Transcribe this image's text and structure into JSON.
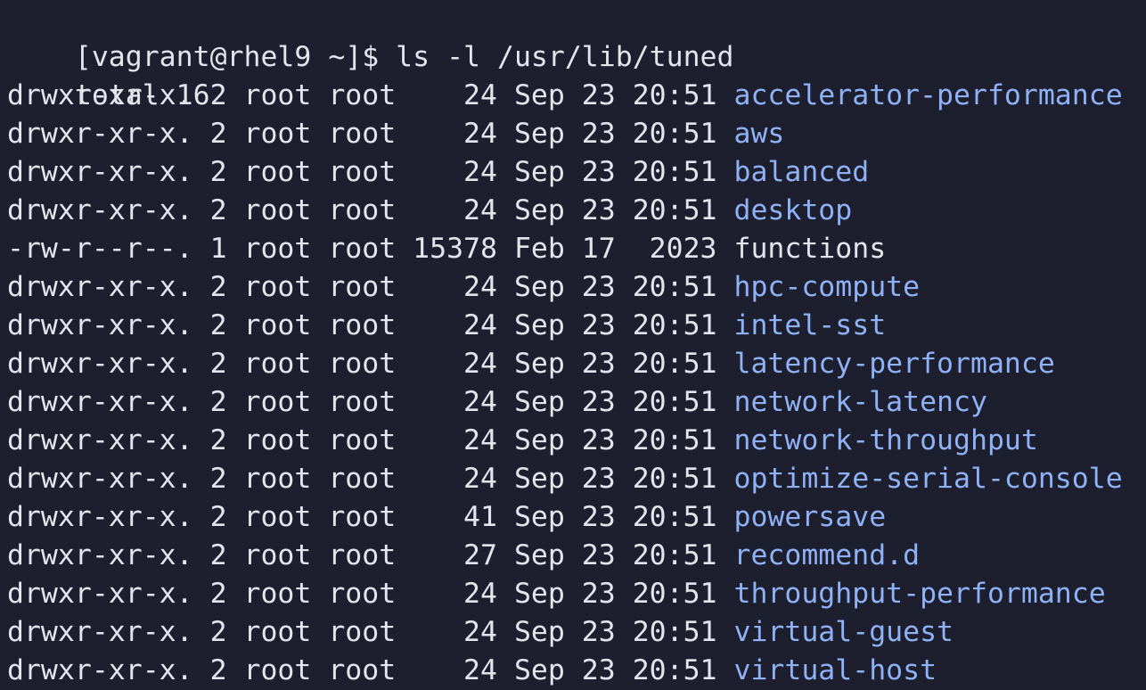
{
  "terminal": {
    "prompt": "[vagrant@rhel9 ~]$ ls -l /usr/lib/tuned",
    "total": "total 16",
    "colors": {
      "background": "#1e1f2e",
      "text": "#e3e5ec",
      "directory": "#8fb1f5"
    },
    "entries": [
      {
        "meta": "drwxr-xr-x. 2 root root    24 Sep 23 20:51 ",
        "name": "accelerator-performance",
        "type": "dir"
      },
      {
        "meta": "drwxr-xr-x. 2 root root    24 Sep 23 20:51 ",
        "name": "aws",
        "type": "dir"
      },
      {
        "meta": "drwxr-xr-x. 2 root root    24 Sep 23 20:51 ",
        "name": "balanced",
        "type": "dir"
      },
      {
        "meta": "drwxr-xr-x. 2 root root    24 Sep 23 20:51 ",
        "name": "desktop",
        "type": "dir"
      },
      {
        "meta": "-rw-r--r--. 1 root root 15378 Feb 17  2023 ",
        "name": "functions",
        "type": "file"
      },
      {
        "meta": "drwxr-xr-x. 2 root root    24 Sep 23 20:51 ",
        "name": "hpc-compute",
        "type": "dir"
      },
      {
        "meta": "drwxr-xr-x. 2 root root    24 Sep 23 20:51 ",
        "name": "intel-sst",
        "type": "dir"
      },
      {
        "meta": "drwxr-xr-x. 2 root root    24 Sep 23 20:51 ",
        "name": "latency-performance",
        "type": "dir"
      },
      {
        "meta": "drwxr-xr-x. 2 root root    24 Sep 23 20:51 ",
        "name": "network-latency",
        "type": "dir"
      },
      {
        "meta": "drwxr-xr-x. 2 root root    24 Sep 23 20:51 ",
        "name": "network-throughput",
        "type": "dir"
      },
      {
        "meta": "drwxr-xr-x. 2 root root    24 Sep 23 20:51 ",
        "name": "optimize-serial-console",
        "type": "dir"
      },
      {
        "meta": "drwxr-xr-x. 2 root root    41 Sep 23 20:51 ",
        "name": "powersave",
        "type": "dir"
      },
      {
        "meta": "drwxr-xr-x. 2 root root    27 Sep 23 20:51 ",
        "name": "recommend.d",
        "type": "dir"
      },
      {
        "meta": "drwxr-xr-x. 2 root root    24 Sep 23 20:51 ",
        "name": "throughput-performance",
        "type": "dir"
      },
      {
        "meta": "drwxr-xr-x. 2 root root    24 Sep 23 20:51 ",
        "name": "virtual-guest",
        "type": "dir"
      },
      {
        "meta": "drwxr-xr-x. 2 root root    24 Sep 23 20:51 ",
        "name": "virtual-host",
        "type": "dir"
      }
    ]
  }
}
